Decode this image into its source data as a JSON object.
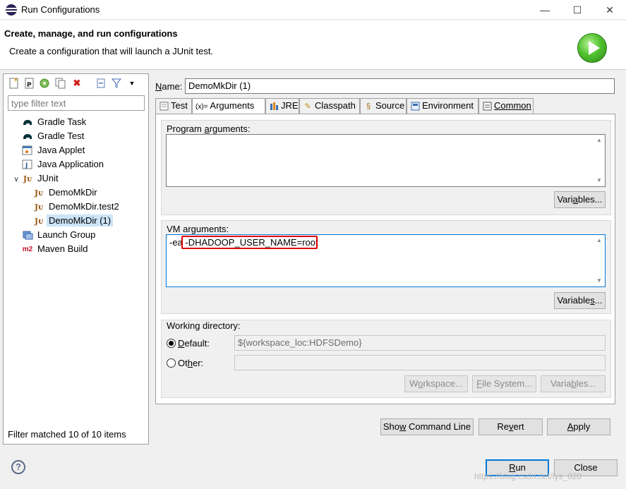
{
  "window": {
    "title": "Run Configurations",
    "controls": {
      "minimize": "—",
      "maximize": "☐",
      "close": "✕"
    }
  },
  "header": {
    "title": "Create, manage, and run configurations",
    "subtitle": "Create a configuration that will launch a JUnit test.",
    "icon": "run-icon"
  },
  "toolbar": {
    "icons": [
      "new-configuration-icon",
      "new-prototype-icon",
      "export-icon",
      "duplicate-icon",
      "delete-icon",
      "collapse-all-icon",
      "filter-icon",
      "view-menu-icon"
    ]
  },
  "filter": {
    "placeholder": "type filter text",
    "status": "Filter matched 10 of 10 items"
  },
  "tree": {
    "items": [
      {
        "label": "Gradle Task",
        "icon": "gradle-icon"
      },
      {
        "label": "Gradle Test",
        "icon": "gradle-icon"
      },
      {
        "label": "Java Applet",
        "icon": "java-applet-icon"
      },
      {
        "label": "Java Application",
        "icon": "java-application-icon"
      },
      {
        "label": "JUnit",
        "icon": "junit-icon",
        "expanded": true
      },
      {
        "label": "DemoMkDir",
        "icon": "junit-icon"
      },
      {
        "label": "DemoMkDir.test2",
        "icon": "junit-icon"
      },
      {
        "label": "DemoMkDir (1)",
        "icon": "junit-icon",
        "selected": true
      },
      {
        "label": "Launch Group",
        "icon": "launch-group-icon"
      },
      {
        "label": "Maven Build",
        "icon": "maven-icon",
        "icon_text": "m2"
      }
    ]
  },
  "name": {
    "label_accel": "N",
    "label_rest": "ame:",
    "value": "DemoMkDir (1)"
  },
  "tabs": [
    {
      "label": "Test",
      "icon": "test-tab-icon"
    },
    {
      "label": "Arguments",
      "icon": "arguments-icon",
      "prefix": "(x)=",
      "active": true
    },
    {
      "label": "JRE",
      "icon": "jre-icon"
    },
    {
      "label": "Classpath",
      "icon": "classpath-icon"
    },
    {
      "label": "Source",
      "icon": "source-icon"
    },
    {
      "label": "Environment",
      "icon": "environment-icon"
    },
    {
      "label": "Common",
      "icon": "common-icon"
    }
  ],
  "program_arguments": {
    "label_a": "Program ",
    "label_accel": "a",
    "label_b": "rguments:",
    "value": "",
    "variables_button": {
      "a": "Vari",
      "accel": "a",
      "b": "bles..."
    }
  },
  "vm_arguments": {
    "label_a": "VM ar",
    "label_accel": "g",
    "label_b": "uments:",
    "value_prefix": "-ea ",
    "value_highlighted": "-DHADOOP_USER_NAME=root",
    "variables_button": {
      "a": "Variable",
      "accel": "s",
      "b": "..."
    }
  },
  "working_directory": {
    "label": "Working directory:",
    "default_label_accel": "D",
    "default_label_rest": "efault:",
    "default_value": "${workspace_loc:HDFSDemo}",
    "other_label_a": "Ot",
    "other_label_accel": "h",
    "other_label_b": "er:",
    "other_value": "",
    "selected": "default",
    "buttons": {
      "workspace": {
        "a": "W",
        "accel": "o",
        "b": "rkspace..."
      },
      "file_system": {
        "a": "",
        "accel": "F",
        "b": "ile System..."
      },
      "variables": {
        "a": "Varia",
        "accel": "b",
        "b": "les..."
      }
    }
  },
  "actions": {
    "show_command_line": {
      "a": "Sho",
      "accel": "w",
      "b": " Command Line"
    },
    "revert": {
      "a": "Re",
      "accel": "v",
      "b": "ert"
    },
    "apply": {
      "a": "",
      "accel": "A",
      "b": "pply"
    },
    "run": {
      "a": "",
      "accel": "R",
      "b": "un"
    },
    "close": "Close"
  },
  "help_icon": "?",
  "watermark": "https://blog.csdn.net/lys_828"
}
